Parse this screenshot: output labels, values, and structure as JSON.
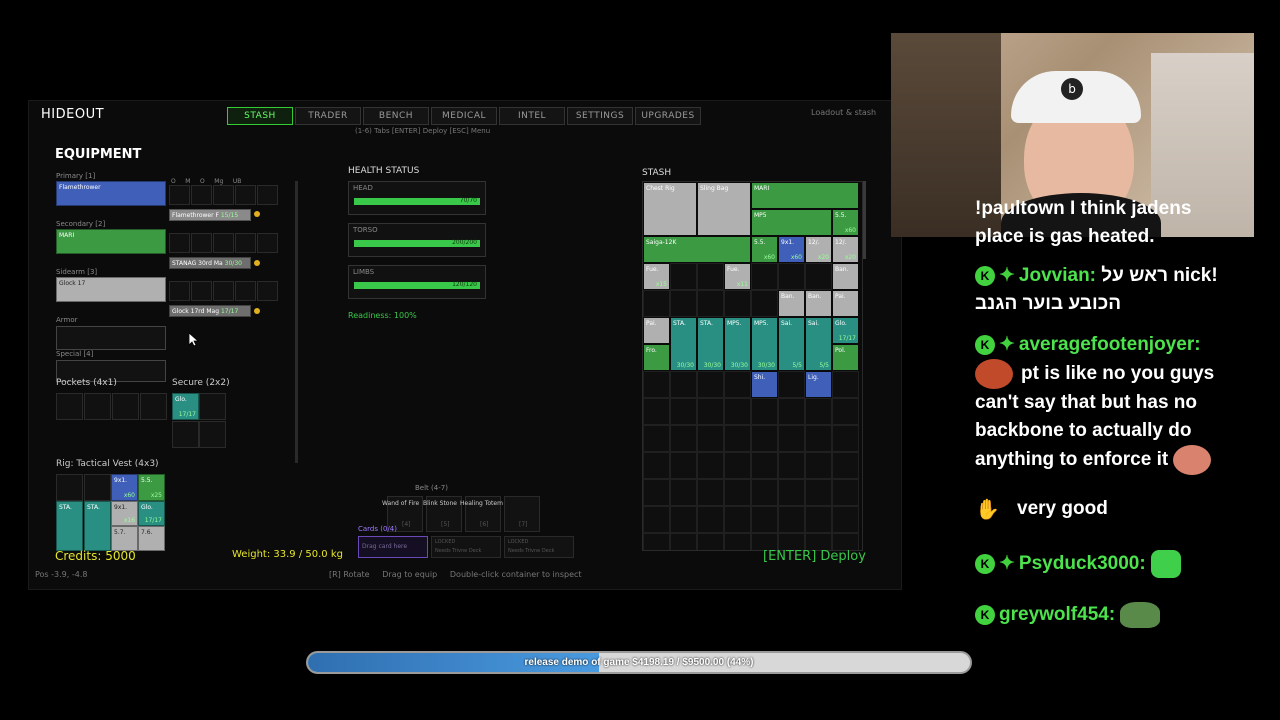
{
  "game": {
    "title": "HIDEOUT",
    "tabs": [
      "STASH",
      "TRADER",
      "BENCH",
      "MEDICAL",
      "INTEL",
      "SETTINGS",
      "UPGRADES"
    ],
    "active_tab": "STASH",
    "hint": "(1-6) Tabs  [ENTER] Deploy  [ESC] Menu",
    "top_right": "Loadout & stash",
    "equipment": {
      "heading": "EQUIPMENT",
      "col_labels": [
        "O",
        "M",
        "O",
        "Mg",
        "UB"
      ],
      "primary_label": "Primary [1]",
      "primary_item": "Flamethrower",
      "primary_ammo": "Flamethrower F",
      "primary_ammo_count": "15/15",
      "secondary_label": "Secondary [2]",
      "secondary_item": "MARI",
      "secondary_ammo": "STANAG 30rd Ma",
      "secondary_ammo_count": "30/30",
      "sidearm_label": "Sidearm [3]",
      "sidearm_item": "Glock 17",
      "sidearm_ammo": "Glock 17rd Mag",
      "sidearm_ammo_count": "17/17",
      "armor_label": "Armor",
      "special_label": "Special [4]",
      "pockets_label": "Pockets (4x1)",
      "secure_label": "Secure (2x2)",
      "secure_item": "Glo.",
      "secure_count": "17/17",
      "rig_label": "Rig: Tactical Vest (4x3)",
      "rig_items": [
        {
          "name": "9x1.",
          "count": "x60"
        },
        {
          "name": "5.5.",
          "count": "x25"
        },
        {
          "name": "STA.",
          "count": ""
        },
        {
          "name": "STA.",
          "count": ""
        },
        {
          "name": "9x1.",
          "count": "x16"
        },
        {
          "name": "Glo.",
          "count": "17/17"
        },
        {
          "name": "5.7.",
          "count": ""
        },
        {
          "name": "7.6.",
          "count": ""
        }
      ]
    },
    "health": {
      "heading": "HEALTH STATUS",
      "head_label": "HEAD",
      "head_val": "70/70",
      "torso_label": "TORSO",
      "torso_val": "200/200",
      "limbs_label": "LIMBS",
      "limbs_val": "120/120",
      "readiness": "Readiness: 100%"
    },
    "belt": {
      "label": "Belt (4-7)",
      "slots": [
        "Wand of Fire",
        "Blink Stone",
        "Healing Totem",
        ""
      ],
      "keys": [
        "[4]",
        "[5]",
        "[6]",
        "[7]"
      ],
      "cards_label": "Cards (0/4)",
      "drag_card": "Drag card here",
      "locked": "LOCKED",
      "needs": "Needs Trivne Deck"
    },
    "stash": {
      "heading": "STASH",
      "items": [
        {
          "name": "Chest Rig",
          "count": ""
        },
        {
          "name": "Sling Bag",
          "count": ""
        },
        {
          "name": "MARI",
          "count": ""
        },
        {
          "name": "MP5",
          "count": ""
        },
        {
          "name": "5.5.",
          "count": "x60"
        },
        {
          "name": "Saiga-12K",
          "count": ""
        },
        {
          "name": "5.5.",
          "count": "x60"
        },
        {
          "name": "9x1.",
          "count": "x60"
        },
        {
          "name": "12/.",
          "count": "x20"
        },
        {
          "name": "12/.",
          "count": "x20"
        },
        {
          "name": "Fue.",
          "count": "x15"
        },
        {
          "name": "Fue.",
          "count": "x11"
        },
        {
          "name": "Ban.",
          "count": ""
        },
        {
          "name": "Ban.",
          "count": ""
        },
        {
          "name": "Ban.",
          "count": ""
        },
        {
          "name": "Pai.",
          "count": ""
        },
        {
          "name": "Pai.",
          "count": ""
        },
        {
          "name": "STA.",
          "count": "30/30"
        },
        {
          "name": "STA.",
          "count": "30/30"
        },
        {
          "name": "MP5.",
          "count": "30/30"
        },
        {
          "name": "MP5.",
          "count": "30/30"
        },
        {
          "name": "Sai.",
          "count": "5/5"
        },
        {
          "name": "Sai.",
          "count": "5/5"
        },
        {
          "name": "Glo.",
          "count": "17/17"
        },
        {
          "name": "Fro.",
          "count": ""
        },
        {
          "name": "Pol.",
          "count": ""
        },
        {
          "name": "Shi.",
          "count": ""
        },
        {
          "name": "Lig.",
          "count": ""
        }
      ]
    },
    "credits": "Credits: 5000",
    "weight": "Weight: 33.9 / 50.0 kg",
    "deploy": "[ENTER] Deploy",
    "pos": "Pos -3.9, -4.8",
    "footer_hints": "[R] Rotate     Drag to equip     Double-click container to inspect"
  },
  "chat": {
    "msg0": "!paultown I think jadens place is gas heated.",
    "msg0_line1": "!paultown I think jadens",
    "msg0_line2": "place is gas heated.",
    "u1": "Jovvian:",
    "u1_text_a": "!nick ראש על",
    "u1_text_b": "הכובע בוער הגנב",
    "u2": "averagefootenjoyer:",
    "u2_l1": "pt is like no you guys",
    "u2_l2": "can't say that but has no",
    "u2_l3": "backbone to actually do",
    "u2_l4": "anything to enforce it",
    "u3_text": "very good",
    "u4": "Psyduck3000:",
    "u5": "greywolf454:"
  },
  "goal": {
    "text": "release demo of game $4198.19 / $9500.00 (44%)",
    "progress": 0.44
  },
  "colors": {
    "accent": "#4ce34c",
    "health": "#3ac84a"
  }
}
